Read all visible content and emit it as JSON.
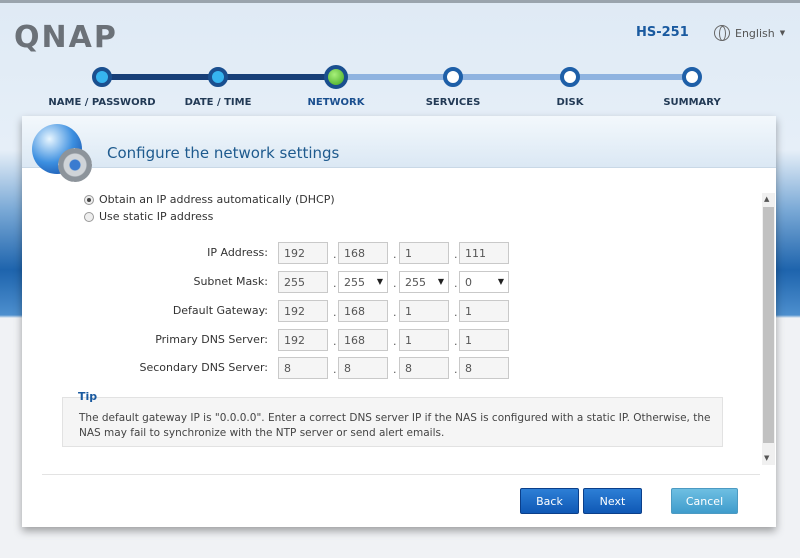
{
  "header": {
    "logo": "QNAP",
    "model": "HS-251",
    "language": "English"
  },
  "steps": [
    {
      "label": "NAME / PASSWORD",
      "state": "done"
    },
    {
      "label": "DATE / TIME",
      "state": "done"
    },
    {
      "label": "NETWORK",
      "state": "current"
    },
    {
      "label": "SERVICES",
      "state": "todo"
    },
    {
      "label": "DISK",
      "state": "todo"
    },
    {
      "label": "SUMMARY",
      "state": "todo"
    }
  ],
  "panel": {
    "title": "Configure the network settings",
    "options": [
      {
        "label": "Obtain an IP address automatically (DHCP)",
        "selected": true
      },
      {
        "label": "Use static IP address",
        "selected": false
      }
    ],
    "fields": [
      {
        "label": "IP Address:",
        "octets": [
          "192",
          "168",
          "1",
          "111"
        ],
        "dropdown": [
          false,
          false,
          false,
          false
        ]
      },
      {
        "label": "Subnet Mask:",
        "octets": [
          "255",
          "255",
          "255",
          "0"
        ],
        "dropdown": [
          false,
          true,
          true,
          true
        ]
      },
      {
        "label": "Default Gateway:",
        "octets": [
          "192",
          "168",
          "1",
          "1"
        ],
        "dropdown": [
          false,
          false,
          false,
          false
        ]
      },
      {
        "label": "Primary DNS Server:",
        "octets": [
          "192",
          "168",
          "1",
          "1"
        ],
        "dropdown": [
          false,
          false,
          false,
          false
        ]
      },
      {
        "label": "Secondary DNS Server:",
        "octets": [
          "8",
          "8",
          "8",
          "8"
        ],
        "dropdown": [
          false,
          false,
          false,
          false
        ]
      }
    ],
    "tip": {
      "title": "Tip",
      "text": "The default gateway IP is \"0.0.0.0\". Enter a correct DNS server IP if the NAS is configured with a static IP. Otherwise, the NAS may fail to synchronize with the NTP server or send alert emails."
    },
    "buttons": {
      "back": "Back",
      "next": "Next",
      "cancel": "Cancel"
    }
  },
  "colors": {
    "accent": "#1a5aa0",
    "done": "#36b4ef",
    "current": "#3fa51f"
  }
}
